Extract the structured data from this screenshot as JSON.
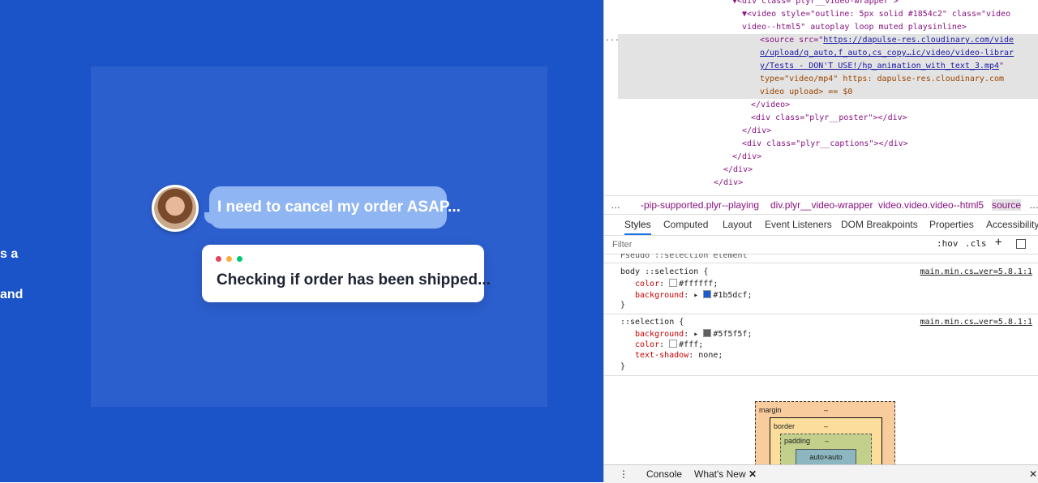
{
  "page": {
    "fragment_1": "s a",
    "fragment_2": "and",
    "video": {
      "message_1": "I need to cancel my order ASAP...",
      "message_2": "Checking if order has been shipped..."
    }
  },
  "devtools": {
    "dom_lines": [
      "▼<div class=\"plyr__video-wrapper\">",
      "▼<video style=\"outline: 5px solid #1854c2\" class=\"video",
      "video--html5\" autoplay loop muted playsinline>",
      "<source src=\"",
      "https://dapulse-res.cloudinary.com/vide",
      "o/upload/q_auto,f_auto,cs_copy…ic/video/video-librar",
      "y/Tests - DON'T USE!/hp_animation_with_text_3.mp4",
      "\"",
      "type=\"video/mp4\" https: dapulse-res.cloudinary.com",
      "video upload> == $0",
      "</video>",
      "<div class=\"plyr__poster\"></div>",
      "</div>",
      "<div class=\"plyr__captions\"></div>",
      "</div>",
      "</div>",
      "</div>"
    ],
    "ellipsis": "...",
    "breadcrumbs": [
      "…",
      "-pip-supported.plyr--playing",
      "div.plyr__video-wrapper",
      "video.video.video--html5",
      "source",
      "…"
    ],
    "tabs": [
      "Styles",
      "Computed",
      "Layout",
      "Event Listeners",
      "DOM Breakpoints",
      "Properties",
      "Accessibility"
    ],
    "filter_placeholder": "Filter",
    "hov": ":hov",
    "cls": ".cls",
    "plus": "+",
    "pseudo_header": "Pseudo ::selection element",
    "rules": [
      {
        "selector": "body ::selection {",
        "source": "main.min.cs…ver=5.8.1:1",
        "props": [
          {
            "name": "color",
            "value": "#ffffff",
            "swatch": "#ffffff"
          },
          {
            "name": "background",
            "value": "#1b5dcf",
            "swatch": "#1b5dcf"
          }
        ]
      },
      {
        "selector": "::selection {",
        "source": "main.min.cs…ver=5.8.1:1",
        "props": [
          {
            "name": "background",
            "value": "#5f5f5f",
            "swatch": "#5f5f5f"
          },
          {
            "name": "color",
            "value": "#fff",
            "swatch": "#ffffff"
          },
          {
            "name": "text-shadow",
            "value": "none"
          }
        ]
      }
    ],
    "close_brace": "}",
    "box_model": {
      "margin_label": "margin",
      "border_label": "border",
      "padding_label": "padding",
      "dash": "–",
      "content": "auto×auto"
    },
    "drawer": {
      "console": "Console",
      "whats_new": "What's New"
    }
  },
  "colors": {
    "page_bg": "#1b54c9",
    "video_bg": "#2c5fce",
    "bubble": "#8fb5f3",
    "accent": "#1a73e8"
  }
}
